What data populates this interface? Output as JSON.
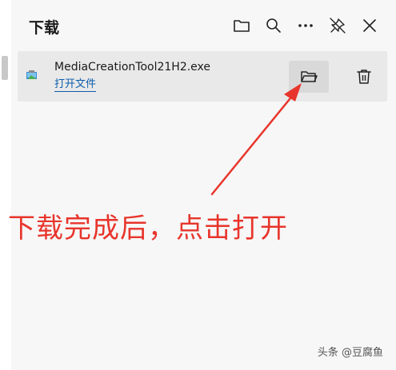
{
  "panel": {
    "title": "下载"
  },
  "header_icons": {
    "open_folder": "folder-icon",
    "search": "search-icon",
    "more": "more-icon",
    "pin": "pin-off-icon",
    "close": "close-icon"
  },
  "download_item": {
    "file_name": "MediaCreationTool21H2.exe",
    "open_link": "打开文件",
    "file_icon": "installer-icon",
    "folder_button_icon": "folder-icon",
    "delete_button_icon": "trash-icon"
  },
  "annotation": {
    "text": "下载完成后，点击打开",
    "color": "#e8352c"
  },
  "watermark": {
    "text": "头条 @豆腐鱼"
  }
}
